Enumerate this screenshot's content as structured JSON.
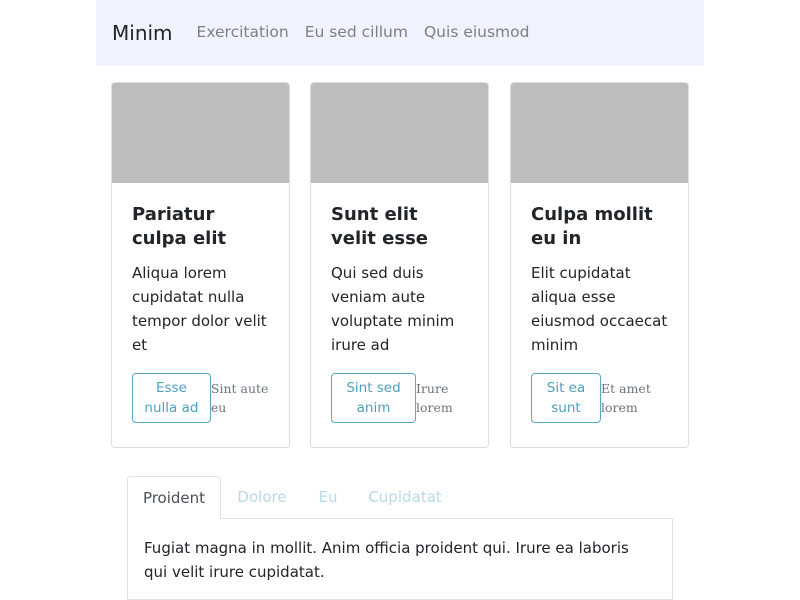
{
  "navbar": {
    "brand": "Minim",
    "links": [
      "Exercitation",
      "Eu sed cillum",
      "Quis eiusmod"
    ]
  },
  "cards": [
    {
      "title": "Pariatur culpa elit",
      "text": "Aliqua lorem cupidatat nulla tempor dolor velit et",
      "button": "Esse nulla ad",
      "note": "Sint aute eu"
    },
    {
      "title": "Sunt elit velit esse",
      "text": "Qui sed duis veniam aute voluptate minim irure ad",
      "button": "Sint sed anim",
      "note": "Irure lorem"
    },
    {
      "title": "Culpa mollit eu in",
      "text": "Elit cupidatat aliqua esse eiusmod occaecat minim",
      "button": "Sit ea sunt",
      "note": "Et amet lorem"
    }
  ],
  "tabs": {
    "items": [
      "Proident",
      "Dolore",
      "Eu",
      "Cupidatat"
    ],
    "active": "Proident",
    "content": "Fugiat magna in mollit. Anim officia proident qui. Irure ea laboris qui velit irure cupidatat."
  },
  "colors": {
    "navbar_bg": "#eef3fe",
    "accent": "#4ea0bf",
    "image_placeholder": "#bdbdbd",
    "inactive_tab": "#b9d9e8"
  }
}
